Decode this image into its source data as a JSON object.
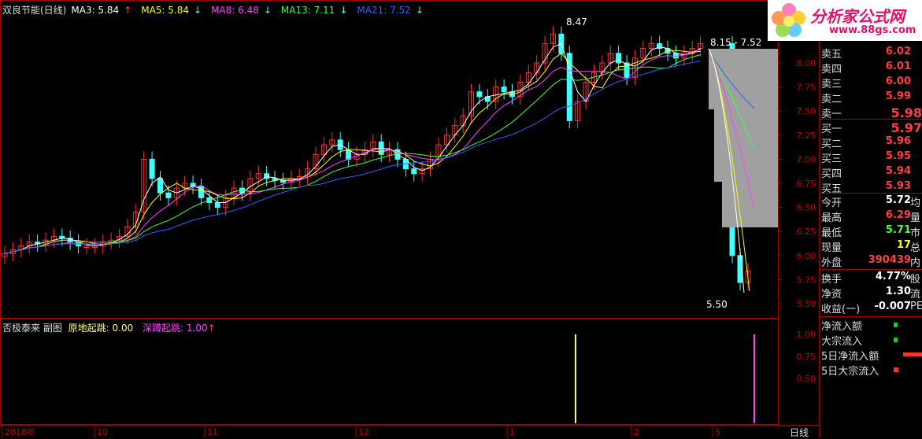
{
  "main_chart": {
    "stock_name": "双良节能(日线)",
    "ma3": {
      "label": "MA3: 5.84",
      "arrow": "↑",
      "color": "#ffffff"
    },
    "ma5": {
      "label": "MA5: 5.84",
      "arrow": "↓",
      "color": "#ffff00"
    },
    "ma8": {
      "label": "MA8: 6.48",
      "arrow": "↓",
      "color": "#ff40ff"
    },
    "ma13": {
      "label": "MA13: 7.11",
      "arrow": "↓",
      "color": "#40ff40"
    },
    "ma21": {
      "label": "MA21: 7.52",
      "arrow": "↓",
      "color": "#3060ff"
    },
    "peak_annotation": "8.47",
    "range_annotation": "8.15 - 7.52",
    "low_annotation": "5.50",
    "y_ticks": [
      "8.00",
      "7.75",
      "7.50",
      "7.25",
      "7.00",
      "6.75",
      "6.50",
      "6.25",
      "6.00",
      "5.75",
      "5.50"
    ]
  },
  "chart_data": {
    "type": "line",
    "title": "双良节能(日线)",
    "ylim": [
      5.4,
      8.4
    ],
    "series": [
      {
        "name": "MA3",
        "last": 5.84
      },
      {
        "name": "MA5",
        "last": 5.84
      },
      {
        "name": "MA8",
        "last": 6.48
      },
      {
        "name": "MA13",
        "last": 7.11
      },
      {
        "name": "MA21",
        "last": 7.52
      }
    ],
    "closes": [
      6.02,
      6.06,
      6.1,
      6.14,
      6.12,
      6.16,
      6.2,
      6.18,
      6.14,
      6.1,
      6.1,
      6.1,
      6.14,
      6.16,
      6.2,
      6.3,
      6.45,
      7.0,
      6.8,
      6.65,
      6.6,
      6.7,
      6.75,
      6.72,
      6.6,
      6.55,
      6.5,
      6.6,
      6.7,
      6.65,
      6.8,
      6.85,
      6.8,
      6.78,
      6.76,
      6.8,
      6.82,
      6.9,
      7.05,
      7.15,
      7.2,
      7.1,
      7.0,
      7.05,
      7.1,
      7.18,
      7.05,
      7.1,
      7.0,
      6.9,
      6.85,
      6.9,
      7.0,
      7.15,
      7.25,
      7.35,
      7.45,
      7.7,
      7.65,
      7.6,
      7.75,
      7.7,
      7.65,
      7.8,
      7.9,
      8.0,
      8.2,
      8.3,
      8.1,
      7.4,
      7.6,
      7.8,
      7.9,
      8.0,
      8.1,
      8.0,
      7.85,
      8.05,
      8.15,
      8.2,
      8.15,
      8.1,
      8.05,
      8.1,
      8.15,
      8.2,
      6.0,
      5.72,
      5.84
    ],
    "x_labels": [
      "2018年",
      "10",
      "11",
      "12",
      "1",
      "2",
      "5"
    ]
  },
  "sub_chart": {
    "title": "否极泰来 副图",
    "item1": {
      "label": "原地起跳: 0.00",
      "color": "#ffff80"
    },
    "item2": {
      "label": "深蹲起跳: 1.00",
      "arrow": "↑",
      "color": "#ff40ff"
    },
    "y_ticks": [
      "1.00",
      "0.75",
      "0.50"
    ],
    "period_label": "日线"
  },
  "order_book": {
    "sell": [
      {
        "label": "卖五",
        "price": "6.02"
      },
      {
        "label": "卖四",
        "price": "6.01"
      },
      {
        "label": "卖三",
        "price": "6.00"
      },
      {
        "label": "卖二",
        "price": "5.99"
      },
      {
        "label": "卖一",
        "price": "5.98"
      }
    ],
    "buy": [
      {
        "label": "买一",
        "price": "5.97"
      },
      {
        "label": "买二",
        "price": "5.96"
      },
      {
        "label": "买三",
        "price": "5.95"
      },
      {
        "label": "买四",
        "price": "5.94"
      },
      {
        "label": "买五",
        "price": "5.93"
      }
    ]
  },
  "stats": [
    {
      "label": "今开",
      "value": "5.72",
      "ext": "均",
      "color": "#ffffff"
    },
    {
      "label": "最高",
      "value": "6.29",
      "ext": "量",
      "color": "#ff4040"
    },
    {
      "label": "最低",
      "value": "5.71",
      "ext": "市",
      "color": "#40ff40"
    },
    {
      "label": "现量",
      "value": "17",
      "ext": "总",
      "color": "#ffff00"
    },
    {
      "label": "外盘",
      "value": "390439",
      "ext": "内",
      "color": "#ff4040"
    }
  ],
  "stats2": [
    {
      "label": "换手",
      "value": "4.77%",
      "ext": "股"
    },
    {
      "label": "净资",
      "value": "1.30",
      "ext": "流"
    },
    {
      "label": "收益(一)",
      "value": "-0.007",
      "ext": "PE"
    }
  ],
  "flow_legend": [
    {
      "label": "净流入额",
      "color": "#00e000"
    },
    {
      "label": "大宗流入",
      "color": "#00e000"
    },
    {
      "label": "5日净流入额",
      "color": "#ff3030"
    },
    {
      "label": "5日大宗流入",
      "color": "#ff3030"
    }
  ],
  "logo": {
    "title": "分析家公式网",
    "url": "www.88gs.com"
  }
}
